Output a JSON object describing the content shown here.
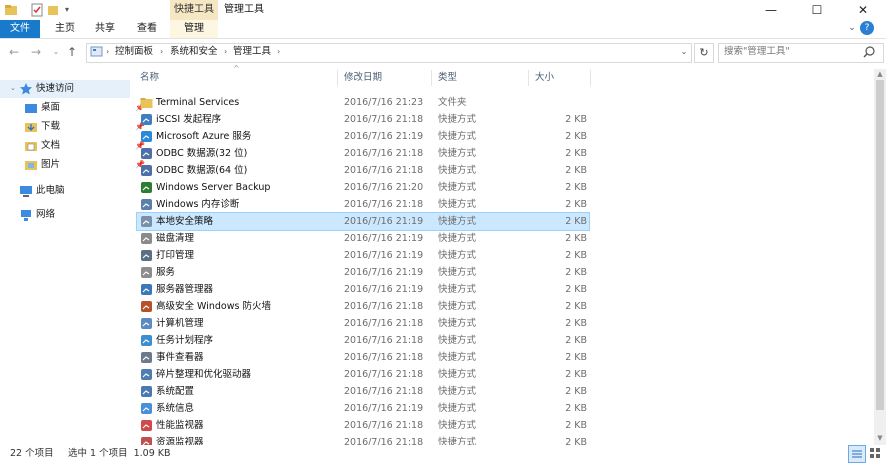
{
  "window": {
    "title": "管理工具",
    "context_tab": "快捷工具",
    "controls": {
      "minimize": "—",
      "maximize": "☐",
      "close": "✕"
    }
  },
  "ribbon": {
    "tabs": [
      "文件",
      "主页",
      "共享",
      "查看",
      "管理"
    ]
  },
  "address": {
    "breadcrumbs": [
      "控制面板",
      "系统和安全",
      "管理工具"
    ],
    "search_placeholder": "搜索\"管理工具\""
  },
  "nav": {
    "quick_access": "快速访问",
    "pinned": [
      "桌面",
      "下载",
      "文档",
      "图片"
    ],
    "this_pc": "此电脑",
    "network": "网络"
  },
  "columns": {
    "name": "名称",
    "date": "修改日期",
    "type": "类型",
    "size": "大小"
  },
  "files": [
    {
      "name": "Terminal Services",
      "date": "2016/7/16 21:23",
      "type": "文件夹",
      "size": "",
      "icon": "folder-icon"
    },
    {
      "name": "iSCSI 发起程序",
      "date": "2016/7/16 21:18",
      "type": "快捷方式",
      "size": "2 KB",
      "icon": "iscsi-icon"
    },
    {
      "name": "Microsoft Azure 服务",
      "date": "2016/7/16 21:19",
      "type": "快捷方式",
      "size": "2 KB",
      "icon": "azure-icon"
    },
    {
      "name": "ODBC 数据源(32 位)",
      "date": "2016/7/16 21:18",
      "type": "快捷方式",
      "size": "2 KB",
      "icon": "odbc-icon"
    },
    {
      "name": "ODBC 数据源(64 位)",
      "date": "2016/7/16 21:18",
      "type": "快捷方式",
      "size": "2 KB",
      "icon": "odbc-icon"
    },
    {
      "name": "Windows Server Backup",
      "date": "2016/7/16 21:20",
      "type": "快捷方式",
      "size": "2 KB",
      "icon": "backup-icon"
    },
    {
      "name": "Windows 内存诊断",
      "date": "2016/7/16 21:18",
      "type": "快捷方式",
      "size": "2 KB",
      "icon": "memory-icon"
    },
    {
      "name": "本地安全策略",
      "date": "2016/7/16 21:19",
      "type": "快捷方式",
      "size": "2 KB",
      "icon": "security-policy-icon"
    },
    {
      "name": "磁盘清理",
      "date": "2016/7/16 21:19",
      "type": "快捷方式",
      "size": "2 KB",
      "icon": "disk-cleanup-icon"
    },
    {
      "name": "打印管理",
      "date": "2016/7/16 21:19",
      "type": "快捷方式",
      "size": "2 KB",
      "icon": "printer-icon"
    },
    {
      "name": "服务",
      "date": "2016/7/16 21:19",
      "type": "快捷方式",
      "size": "2 KB",
      "icon": "services-icon"
    },
    {
      "name": "服务器管理器",
      "date": "2016/7/16 21:19",
      "type": "快捷方式",
      "size": "2 KB",
      "icon": "server-manager-icon"
    },
    {
      "name": "高级安全 Windows 防火墙",
      "date": "2016/7/16 21:18",
      "type": "快捷方式",
      "size": "2 KB",
      "icon": "firewall-icon"
    },
    {
      "name": "计算机管理",
      "date": "2016/7/16 21:18",
      "type": "快捷方式",
      "size": "2 KB",
      "icon": "computer-management-icon"
    },
    {
      "name": "任务计划程序",
      "date": "2016/7/16 21:18",
      "type": "快捷方式",
      "size": "2 KB",
      "icon": "task-scheduler-icon"
    },
    {
      "name": "事件查看器",
      "date": "2016/7/16 21:18",
      "type": "快捷方式",
      "size": "2 KB",
      "icon": "event-viewer-icon"
    },
    {
      "name": "碎片整理和优化驱动器",
      "date": "2016/7/16 21:18",
      "type": "快捷方式",
      "size": "2 KB",
      "icon": "defrag-icon"
    },
    {
      "name": "系统配置",
      "date": "2016/7/16 21:18",
      "type": "快捷方式",
      "size": "2 KB",
      "icon": "system-config-icon"
    },
    {
      "name": "系统信息",
      "date": "2016/7/16 21:19",
      "type": "快捷方式",
      "size": "2 KB",
      "icon": "system-info-icon"
    },
    {
      "name": "性能监视器",
      "date": "2016/7/16 21:18",
      "type": "快捷方式",
      "size": "2 KB",
      "icon": "performance-icon"
    },
    {
      "name": "资源监视器",
      "date": "2016/7/16 21:18",
      "type": "快捷方式",
      "size": "2 KB",
      "icon": "resource-monitor-icon"
    }
  ],
  "selected_index": 7,
  "status": {
    "count": "22 个项目",
    "selection": "选中 1 个项目  1.09 KB"
  },
  "colors": {
    "accent": "#1979ca",
    "selection": "#cce8ff",
    "context_tab": "#f6e7c4"
  }
}
